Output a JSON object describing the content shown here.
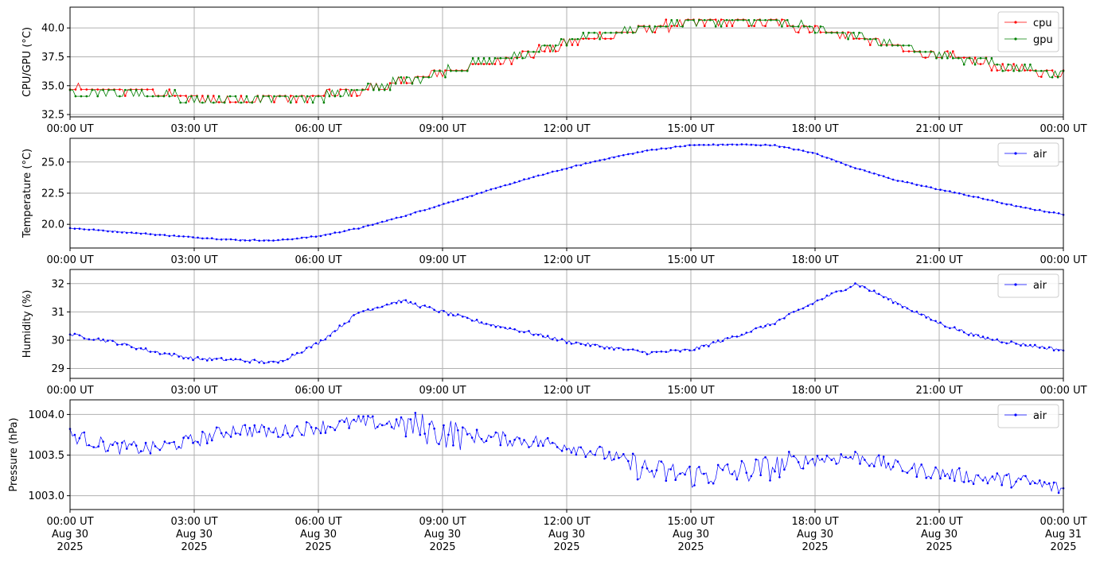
{
  "chart_data": [
    {
      "type": "line",
      "ylabel": "CPU/GPU (°C)",
      "ylim": [
        32.3,
        41.8
      ],
      "yticks": [
        32.5,
        35.0,
        37.5,
        40.0
      ],
      "yticklabels": [
        "32.5",
        "35.0",
        "37.5",
        "40.0"
      ],
      "xticklabels": [
        "00:00 UT",
        "03:00 UT",
        "06:00 UT",
        "09:00 UT",
        "12:00 UT",
        "15:00 UT",
        "18:00 UT",
        "21:00 UT",
        "00:00 UT"
      ],
      "legend_position": "top-right",
      "grid": true,
      "x_hours": [
        0,
        1,
        2,
        3,
        4,
        5,
        6,
        7,
        8,
        9,
        10,
        11,
        12,
        13,
        14,
        15,
        16,
        17,
        18,
        19,
        20,
        21,
        22,
        23,
        24
      ],
      "series": [
        {
          "name": "cpu",
          "color": "#ff0000",
          "values": [
            34.6,
            34.7,
            34.5,
            33.8,
            33.7,
            33.9,
            34.1,
            34.5,
            35.3,
            36.1,
            36.8,
            37.6,
            38.6,
            39.3,
            39.9,
            40.4,
            40.5,
            40.4,
            39.8,
            39.2,
            38.2,
            37.6,
            37.0,
            36.4,
            36.0
          ]
        },
        {
          "name": "gpu",
          "color": "#008000",
          "values": [
            34.5,
            34.6,
            34.4,
            33.8,
            33.8,
            33.9,
            34.1,
            34.6,
            35.4,
            36.3,
            37.0,
            37.8,
            38.8,
            39.5,
            40.0,
            40.5,
            40.6,
            40.5,
            40.0,
            39.3,
            38.4,
            37.7,
            37.1,
            36.5,
            36.1
          ]
        }
      ]
    },
    {
      "type": "line",
      "ylabel": "Temperature (°C)",
      "ylim": [
        18.1,
        26.9
      ],
      "yticks": [
        20.0,
        22.5,
        25.0
      ],
      "yticklabels": [
        "20.0",
        "22.5",
        "25.0"
      ],
      "xticklabels": [
        "00:00 UT",
        "03:00 UT",
        "06:00 UT",
        "09:00 UT",
        "12:00 UT",
        "15:00 UT",
        "18:00 UT",
        "21:00 UT",
        "00:00 UT"
      ],
      "legend_position": "top-right",
      "grid": true,
      "x_hours": [
        0,
        1,
        2,
        3,
        4,
        5,
        6,
        7,
        8,
        9,
        10,
        11,
        12,
        13,
        14,
        15,
        16,
        17,
        18,
        19,
        20,
        21,
        22,
        23,
        24
      ],
      "series": [
        {
          "name": "air",
          "color": "#0000ff",
          "values": [
            19.7,
            19.45,
            19.2,
            18.95,
            18.75,
            18.7,
            19.05,
            19.7,
            20.6,
            21.6,
            22.6,
            23.6,
            24.5,
            25.3,
            25.95,
            26.35,
            26.4,
            26.35,
            25.7,
            24.5,
            23.5,
            22.8,
            22.1,
            21.35,
            20.8
          ]
        }
      ]
    },
    {
      "type": "line",
      "ylabel": "Humidity (%)",
      "ylim": [
        28.65,
        32.5
      ],
      "yticks": [
        29,
        30,
        31,
        32
      ],
      "yticklabels": [
        "29",
        "30",
        "31",
        "32"
      ],
      "xticklabels": [
        "00:00 UT",
        "03:00 UT",
        "06:00 UT",
        "09:00 UT",
        "12:00 UT",
        "15:00 UT",
        "18:00 UT",
        "21:00 UT",
        "00:00 UT"
      ],
      "legend_position": "top-right",
      "grid": true,
      "x_hours": [
        0,
        1,
        2,
        3,
        4,
        5,
        6,
        7,
        8,
        9,
        10,
        11,
        12,
        13,
        14,
        15,
        16,
        17,
        18,
        19,
        20,
        21,
        22,
        23,
        24
      ],
      "series": [
        {
          "name": "air",
          "color": "#0000ff",
          "values": [
            30.2,
            29.95,
            29.6,
            29.35,
            29.3,
            29.2,
            29.9,
            31.0,
            31.4,
            31.0,
            30.6,
            30.3,
            29.95,
            29.75,
            29.55,
            29.65,
            30.1,
            30.6,
            31.35,
            32.0,
            31.3,
            30.6,
            30.1,
            29.85,
            29.65
          ]
        }
      ]
    },
    {
      "type": "line",
      "ylabel": "Pressure (hPa)",
      "ylim": [
        1002.83,
        1004.18
      ],
      "yticks": [
        1003.0,
        1003.5,
        1004.0
      ],
      "yticklabels": [
        "1003.0",
        "1003.5",
        "1004.0"
      ],
      "xticklabels": [
        "00:00 UT\nAug 30\n2025",
        "03:00 UT\nAug 30\n2025",
        "06:00 UT\nAug 30\n2025",
        "09:00 UT\nAug 30\n2025",
        "12:00 UT\nAug 30\n2025",
        "15:00 UT\nAug 30\n2025",
        "18:00 UT\nAug 30\n2025",
        "21:00 UT\nAug 30\n2025",
        "00:00 UT\nAug 31\n2025"
      ],
      "legend_position": "top-right",
      "grid": true,
      "x_hours": [
        0,
        1,
        2,
        3,
        4,
        5,
        6,
        7,
        8,
        9,
        10,
        11,
        12,
        13,
        14,
        15,
        16,
        17,
        18,
        19,
        20,
        21,
        22,
        23,
        24
      ],
      "series": [
        {
          "name": "air",
          "color": "#0000ff",
          "values": [
            1003.75,
            1003.6,
            1003.58,
            1003.68,
            1003.82,
            1003.78,
            1003.85,
            1003.9,
            1003.88,
            1003.78,
            1003.72,
            1003.68,
            1003.62,
            1003.5,
            1003.3,
            1003.25,
            1003.28,
            1003.35,
            1003.45,
            1003.48,
            1003.35,
            1003.28,
            1003.22,
            1003.18,
            1003.08
          ]
        }
      ]
    }
  ]
}
